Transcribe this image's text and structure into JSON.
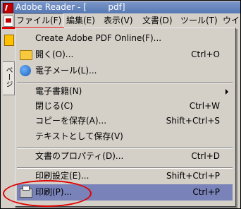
{
  "titlebar": {
    "title": "Adobe Reader - [        pdf]"
  },
  "menubar": {
    "items": [
      "ファイル(F)",
      "編集(E)",
      "表示(V)",
      "文書(D)",
      "ツール(T)",
      "ウイ"
    ]
  },
  "sidepanel": {
    "tab_label": "ページ"
  },
  "file_menu": {
    "create_pdf": {
      "label": "Create Adobe PDF Online(F)...",
      "shortcut": ""
    },
    "open": {
      "label": "開く(O)...",
      "shortcut": "Ctrl+O"
    },
    "email": {
      "label": "電子メール(L)...",
      "shortcut": ""
    },
    "ebooks": {
      "label": "電子書籍(N)",
      "shortcut": ""
    },
    "close": {
      "label": "閉じる(C)",
      "shortcut": "Ctrl+W"
    },
    "save_copy": {
      "label": "コピーを保存(A)...",
      "shortcut": "Shift+Ctrl+S"
    },
    "save_text": {
      "label": "テキストとして保存(V)",
      "shortcut": ""
    },
    "properties": {
      "label": "文書のプロパティ(D)...",
      "shortcut": "Ctrl+D"
    },
    "print_setup": {
      "label": "印刷設定(E)...",
      "shortcut": "Shift+Ctrl+P"
    },
    "print": {
      "label": "印刷(P)...",
      "shortcut": "Ctrl+P"
    }
  },
  "colors": {
    "highlight": "#7a83b9",
    "annotation": "#e00000"
  }
}
